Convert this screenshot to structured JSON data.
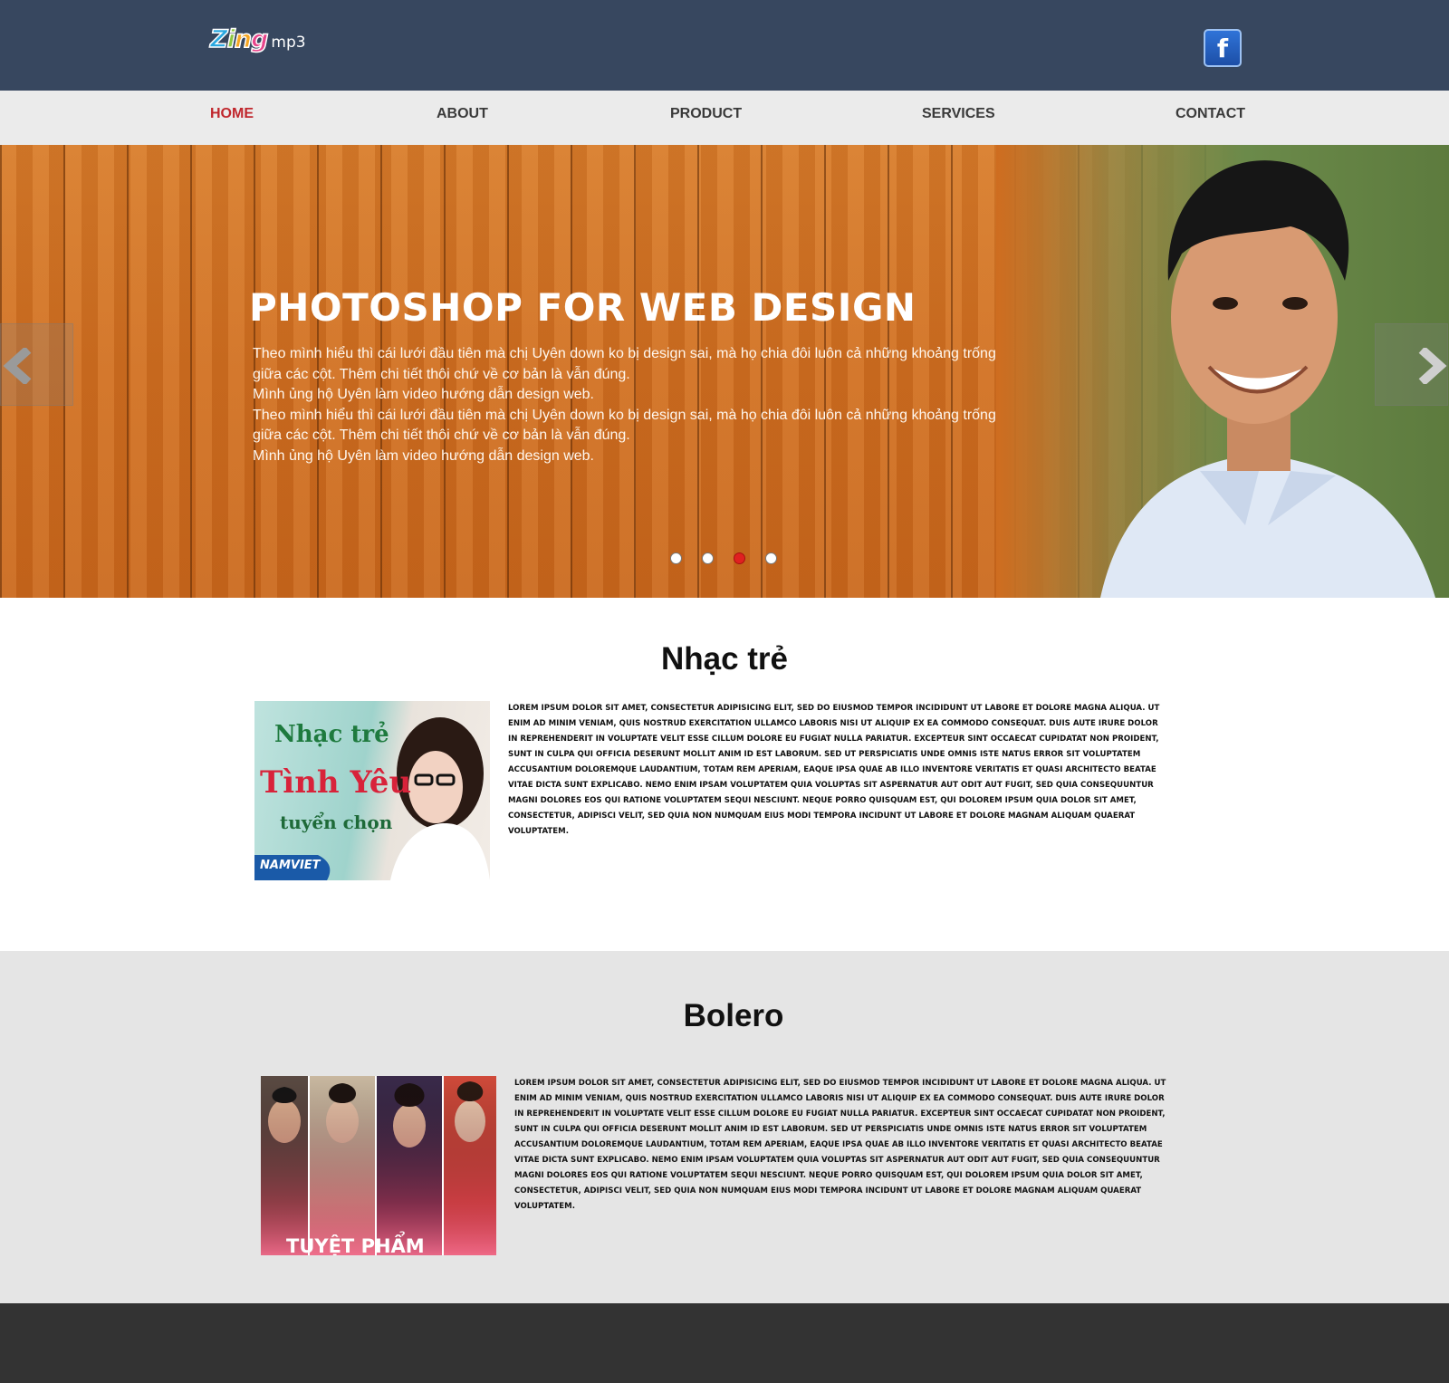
{
  "header": {
    "logo_brand": "Zing",
    "logo_suffix": "mp3",
    "facebook_icon": "facebook-icon"
  },
  "nav": {
    "items": [
      {
        "label": "HOME",
        "active": true
      },
      {
        "label": "ABOUT",
        "active": false
      },
      {
        "label": "PRODUCT",
        "active": false
      },
      {
        "label": "SERVICES",
        "active": false
      },
      {
        "label": "CONTACT",
        "active": false
      }
    ]
  },
  "hero": {
    "title": "PHOTOSHOP FOR WEB DESIGN",
    "lines": [
      "Theo mình hiểu thì cái lưới đầu tiên mà chị Uyên down ko bị design sai, mà họ chia đôi luôn cả những khoảng trống",
      "giữa các cột. Thêm chi tiết thôi chứ về cơ bản là vẫn đúng.",
      "Mình ủng hộ Uyên làm video hướng dẫn design web.",
      "Theo mình hiểu thì cái lưới đầu tiên mà chị Uyên down ko bị design sai, mà họ chia đôi luôn cả những khoảng trống",
      "giữa các cột. Thêm chi tiết thôi chứ về cơ bản là vẫn đúng.",
      "Mình ủng hộ Uyên làm video hướng dẫn design web."
    ],
    "slides_total": 4,
    "active_slide": 3,
    "prev_icon": "chevron-left-icon",
    "next_icon": "chevron-right-icon"
  },
  "sections": [
    {
      "title": "Nhạc trẻ",
      "image_text": [
        "Nhạc trẻ",
        "Tình Yêu",
        "tuyển chọn",
        "NAMVIET"
      ],
      "body": "Lorem ipsum dolor sit amet, consectetur adipisicing elit, sed do eiusmod tempor incididunt ut labore et dolore magna aliqua. Ut enim ad minim veniam, quis nostrud exercitation ullamco laboris nisi ut aliquip ex ea commodo consequat. Duis aute irure dolor in reprehenderit in voluptate velit esse cillum dolore eu fugiat nulla pariatur. Excepteur sint occaecat cupidatat non proident, sunt in culpa qui officia deserunt mollit anim id est laborum. Sed ut perspiciatis unde omnis iste natus error sit voluptatem accusantium doloremque laudantium, totam rem aperiam, eaque ipsa quae ab illo inventore veritatis et quasi architecto beatae vitae dicta sunt explicabo. Nemo enim ipsam voluptatem quia voluptas sit aspernatur aut odit aut fugit, sed quia consequuntur magni dolores eos qui ratione voluptatem sequi nesciunt. Neque porro quisquam est, qui dolorem ipsum quia dolor sit amet, consectetur, adipisci velit, sed quia non numquam eius modi tempora incidunt ut labore et dolore magnam aliquam quaerat voluptatem."
    },
    {
      "title": "Bolero",
      "image_text": [
        "TUYỆT PHẨM"
      ],
      "body": "Lorem ipsum dolor sit amet, consectetur adipisicing elit, sed do eiusmod tempor incididunt ut labore et dolore magna aliqua. Ut enim ad minim veniam, quis nostrud exercitation ullamco laboris nisi ut aliquip ex ea commodo consequat. Duis aute irure dolor in reprehenderit in voluptate velit esse cillum dolore eu fugiat nulla pariatur. Excepteur sint occaecat cupidatat non proident, sunt in culpa qui officia deserunt mollit anim id est laborum. Sed ut perspiciatis unde omnis iste natus error sit voluptatem accusantium doloremque laudantium, totam rem aperiam, eaque ipsa quae ab illo inventore veritatis et quasi architecto beatae vitae dicta sunt explicabo. Nemo enim ipsam voluptatem quia voluptas sit aspernatur aut odit aut fugit, sed quia consequuntur magni dolores eos qui ratione voluptatem sequi nesciunt. Neque porro quisquam est, qui dolorem ipsum quia dolor sit amet, consectetur, adipisci velit, sed quia non numquam eius modi tempora incidunt ut labore et dolore magnam aliquam quaerat voluptatem."
    }
  ],
  "colors": {
    "header_bg": "#37475f",
    "nav_bg": "#ebebeb",
    "nav_active": "#c0272d",
    "section_alt_bg": "#e5e5e5",
    "footer_bg": "#333333",
    "dot_active": "#e02020"
  }
}
